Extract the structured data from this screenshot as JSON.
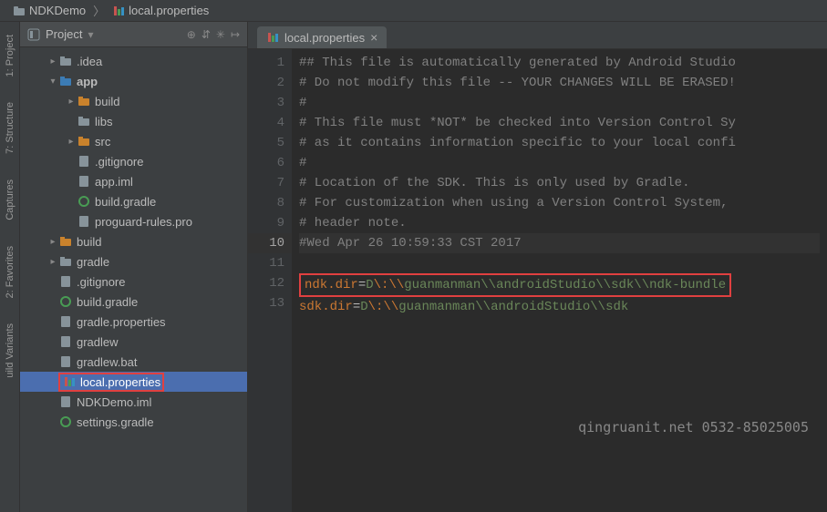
{
  "crumbs": {
    "root": "NDKDemo",
    "file": "local.properties"
  },
  "panel_title": "Project",
  "lbar": {
    "project": "1: Project",
    "structure": "7: Structure",
    "captures": "Captures",
    "favorites": "2: Favorites",
    "variants": "uild Variants"
  },
  "tree": {
    "idea": ".idea",
    "app": "app",
    "app_build": "build",
    "libs": "libs",
    "src": "src",
    "gitignore_app": ".gitignore",
    "app_iml": "app.iml",
    "build_gradle_app": "build.gradle",
    "proguard": "proguard-rules.pro",
    "build": "build",
    "gradle": "gradle",
    "gitignore": ".gitignore",
    "build_gradle": "build.gradle",
    "gradle_props": "gradle.properties",
    "gradlew": "gradlew",
    "gradlew_bat": "gradlew.bat",
    "local_props": "local.properties",
    "ndkdemo_iml": "NDKDemo.iml",
    "settings_gradle": "settings.gradle"
  },
  "tab": {
    "name": "local.properties"
  },
  "gutter": [
    "1",
    "2",
    "3",
    "4",
    "5",
    "6",
    "7",
    "8",
    "9",
    "10",
    "11",
    "12",
    "13"
  ],
  "code": {
    "l1": "## This file is automatically generated by Android Studio",
    "l2": "# Do not modify this file -- YOUR CHANGES WILL BE ERASED!",
    "l3": "#",
    "l4": "# This file must *NOT* be checked into Version Control Sy",
    "l5": "# as it contains information specific to your local confi",
    "l6": "#",
    "l7": "# Location of the SDK. This is only used by Gradle.",
    "l8": "# For customization when using a Version Control System, ",
    "l9": "# header note.",
    "l10": "#Wed Apr 26 10:59:33 CST 2017",
    "l11_key": "ndk.dir",
    "l11_d": "D",
    "l11_path": "guanmanman\\\\androidStudio\\\\sdk\\\\ndk-bundle",
    "l12_key": "sdk.dir",
    "l12_d": "D",
    "l12_path": "guanmanman\\\\androidStudio\\\\sdk",
    "esc_colon": "\\:",
    "esc_bs": "\\\\"
  },
  "watermark": "qingruanit.net 0532-85025005"
}
